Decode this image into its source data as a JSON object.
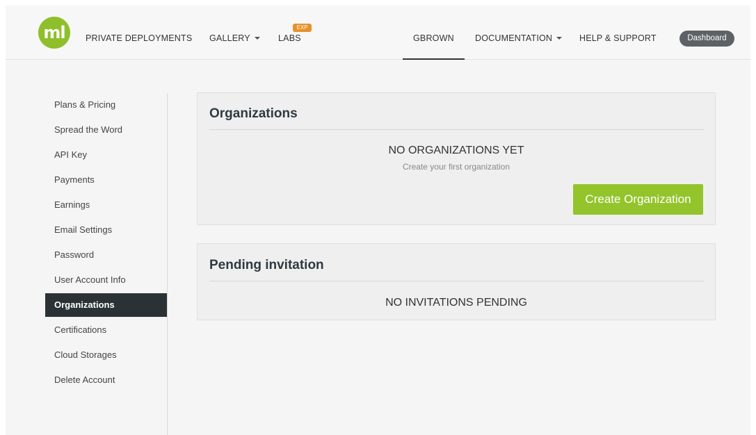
{
  "header": {
    "logo_text": "ml",
    "nav": {
      "private_deployments": "PRIVATE DEPLOYMENTS",
      "gallery": "GALLERY",
      "labs": "LABS",
      "labs_badge": "EXP",
      "user": "GBROWN",
      "documentation": "DOCUMENTATION",
      "help_support": "HELP & SUPPORT"
    },
    "dashboard_label": "Dashboard"
  },
  "sidebar": {
    "items": [
      {
        "label": "Plans & Pricing"
      },
      {
        "label": "Spread the Word"
      },
      {
        "label": "API Key"
      },
      {
        "label": "Payments"
      },
      {
        "label": "Earnings"
      },
      {
        "label": "Email Settings"
      },
      {
        "label": "Password"
      },
      {
        "label": "User Account Info"
      },
      {
        "label": "Organizations",
        "active": true
      },
      {
        "label": "Certifications"
      },
      {
        "label": "Cloud Storages"
      },
      {
        "label": "Delete Account"
      }
    ]
  },
  "organizations": {
    "title": "Organizations",
    "empty_title": "NO ORGANIZATIONS YET",
    "empty_subtitle": "Create your first organization",
    "create_button": "Create Organization"
  },
  "pending": {
    "title": "Pending invitation",
    "empty_title": "NO INVITATIONS PENDING"
  },
  "colors": {
    "brand_green": "#94c42b",
    "labs_badge": "#e8902b",
    "sidebar_active": "#2b3236",
    "dashboard_button": "#5d6266"
  }
}
